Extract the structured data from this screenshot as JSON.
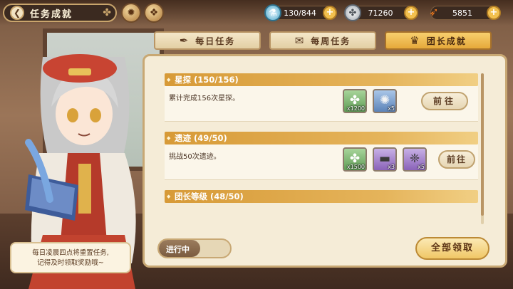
{
  "header": {
    "title": "任务成就",
    "back_icon": "back-arrow-icon",
    "title_deco_icon": "clover-icon",
    "shortcut_icons": [
      "compass-medal-icon",
      "book-scroll-icon"
    ]
  },
  "resources": {
    "stamina": {
      "icon": "potion-bottle-icon",
      "value": "130/844",
      "fill_fraction": 0.154
    },
    "coins": {
      "icon": "silver-clover-coin-icon",
      "value": "71260"
    },
    "carrots": {
      "icon": "carrot-icon",
      "value": "5851"
    },
    "plus_label": "+"
  },
  "tabs": [
    {
      "label": "每日任务",
      "icon": "feather-quill-icon",
      "active": false
    },
    {
      "label": "每周任务",
      "icon": "scroll-icon",
      "active": false
    },
    {
      "label": "团长成就",
      "icon": "trophy-cup-icon",
      "active": true
    }
  ],
  "achievements": [
    {
      "title": "星探 (150/156)",
      "desc": "累计完成156次星探。",
      "rewards": [
        {
          "icon": "silver-coin-icon",
          "count": "x1200",
          "rarity": "green"
        },
        {
          "icon": "crystal-orb-icon",
          "count": "x5",
          "rarity": "blue"
        }
      ],
      "button": "前往"
    },
    {
      "title": "遗迹 (49/50)",
      "desc": "挑战50次遗迹。",
      "rewards": [
        {
          "icon": "silver-coin-icon",
          "count": "x1500",
          "rarity": "green"
        },
        {
          "icon": "stone-tablet-icon",
          "count": "x3",
          "rarity": "purple"
        },
        {
          "icon": "rainbow-crystal-icon",
          "count": "x5",
          "rarity": "purple"
        }
      ],
      "button": "前往"
    },
    {
      "title": "团长等级 (48/50)",
      "desc": "",
      "rewards": [],
      "button": ""
    }
  ],
  "footer": {
    "status_label": "进行中",
    "claim_all_label": "全部领取"
  },
  "tip": {
    "line1": "每日凌晨四点将重置任务,",
    "line2": "记得及时领取奖励哦~"
  },
  "colors": {
    "tab_active": "#e6a93a",
    "row_header": "#d79a37",
    "panel_bg": "#f5ecd7",
    "plus_button": "#f2c04e"
  }
}
